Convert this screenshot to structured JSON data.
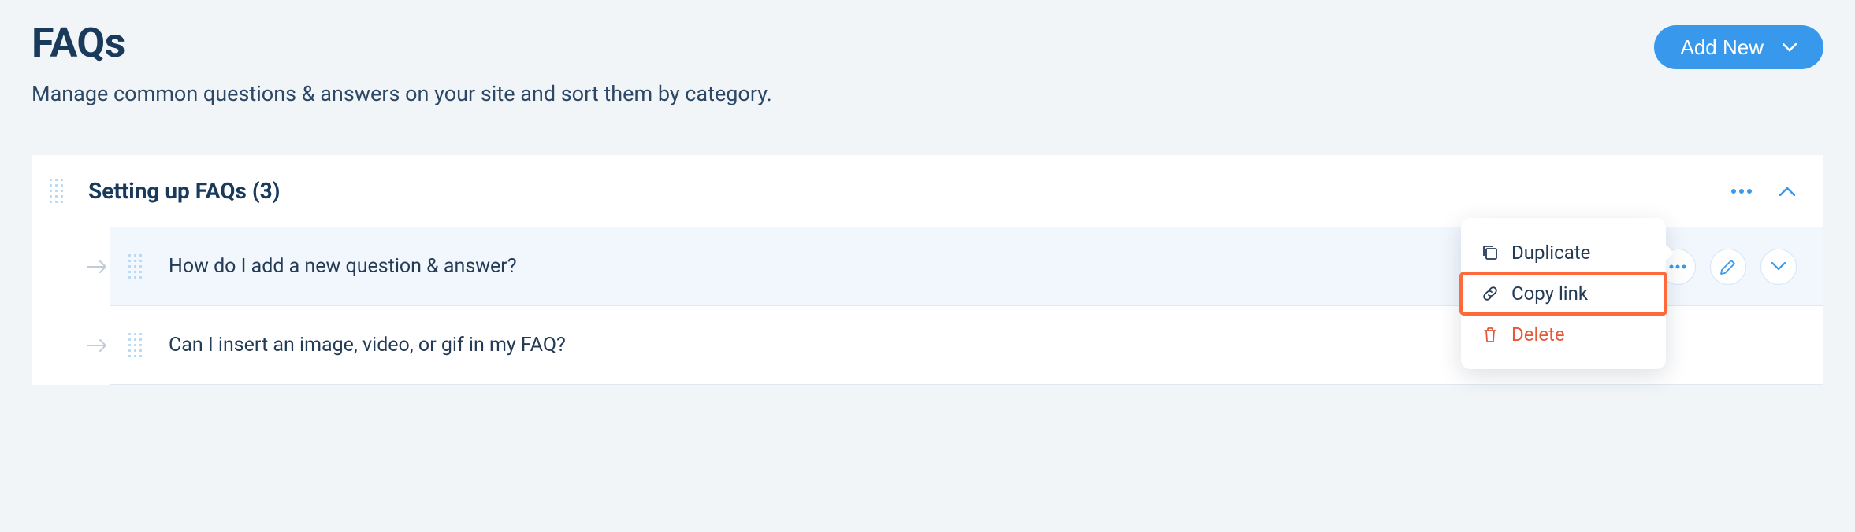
{
  "header": {
    "title": "FAQs",
    "subtitle": "Manage common questions & answers on your site and sort them by category.",
    "addNewLabel": "Add New"
  },
  "category": {
    "title": "Setting up FAQs (3)"
  },
  "questions": [
    {
      "text": "How do I add a new question & answer?"
    },
    {
      "text": "Can I insert an image, video, or gif in my FAQ?"
    }
  ],
  "popover": {
    "duplicate": "Duplicate",
    "copyLink": "Copy link",
    "delete": "Delete"
  }
}
